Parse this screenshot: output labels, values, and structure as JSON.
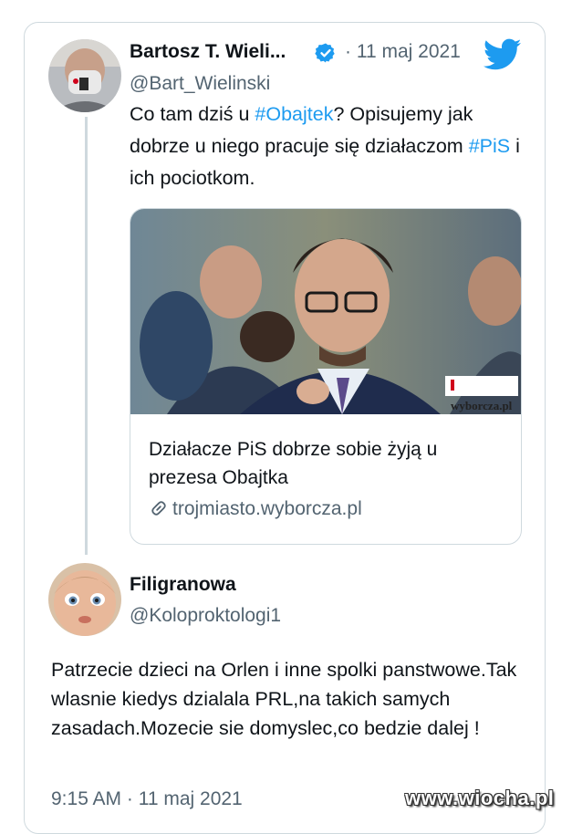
{
  "original_tweet": {
    "author_name": "Bartosz T. Wieli...",
    "handle": "@Bart_Wielinski",
    "date": "· 11 maj 2021",
    "text_parts": [
      "Co tam dziś u ",
      "#Obajtek",
      "? Opisujemy jak dobrze u niego pracuje się działaczom ",
      "#PiS",
      " i ich pociotkom."
    ],
    "link_card": {
      "title": "Działacze PiS dobrze sobie żyją u prezesa Obajtka",
      "domain": "trojmiasto.wyborcza.pl",
      "image_badge": "wyborcza.pl"
    }
  },
  "reply_tweet": {
    "author_name": "Filigranowa",
    "handle": "@Koloproktologi1",
    "text": "Patrzecie dzieci na Orlen i inne spolki panstwowe.Tak wlasnie kiedys dzialala PRL,na takich samych zasadach.Mozecie sie domyslec,co bedzie dalej !",
    "timestamp": "9:15 AM · 11 maj 2021"
  },
  "watermark": "www.wiocha.pl",
  "colors": {
    "link_blue": "#1d9bf0",
    "secondary_text": "#536471",
    "border": "#cfd9de",
    "verified_blue": "#1d9bf0"
  },
  "icons": [
    "verified-badge-icon",
    "twitter-bird-icon",
    "link-icon"
  ]
}
